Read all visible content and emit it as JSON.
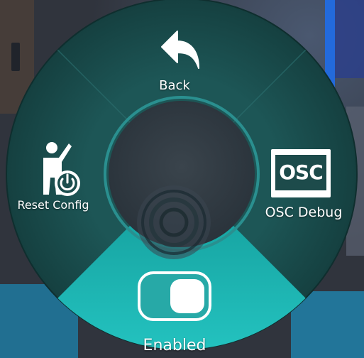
{
  "radial_menu": {
    "items": [
      {
        "id": "back",
        "label": "Back",
        "icon": "back-arrow-icon",
        "active": false
      },
      {
        "id": "osc",
        "label": "OSC Debug",
        "icon": "osc-icon",
        "active": false
      },
      {
        "id": "enabled",
        "label": "Enabled",
        "icon": "toggle-switch-icon",
        "active": true,
        "toggle_on": true
      },
      {
        "id": "reset",
        "label": "Reset Config",
        "icon": "avatar-power-icon",
        "active": false
      }
    ],
    "osc_icon_text": "OSC",
    "center_icon": "concentric-rings-icon"
  },
  "colors": {
    "ring_dark": "#1b4d4d",
    "ring_active": "#1fb5b3",
    "center_bg": "#2f3a42",
    "rim": "#2a8f8f",
    "label": "#ffffff"
  }
}
